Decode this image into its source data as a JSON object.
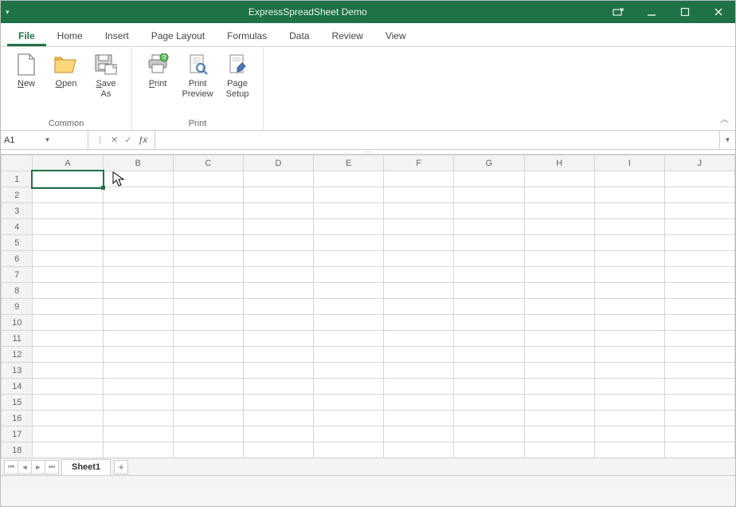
{
  "titlebar": {
    "title": "ExpressSpreadSheet Demo"
  },
  "tabs": {
    "file": "File",
    "home": "Home",
    "insert": "Insert",
    "layout": "Page Layout",
    "formulas": "Formulas",
    "data": "Data",
    "review": "Review",
    "view": "View"
  },
  "ribbon": {
    "common": {
      "caption": "Common",
      "new": "ew",
      "new_pre": "N",
      "open": "pen",
      "open_pre": "O",
      "save": "ave\nAs",
      "save_pre": "S"
    },
    "print": {
      "caption": "Print",
      "print": "rint",
      "print_pre": "P",
      "preview": "Print\nPreview",
      "setup": "Page\nSetup"
    }
  },
  "namebox": "A1",
  "formula": "",
  "columns": [
    "A",
    "B",
    "C",
    "D",
    "E",
    "F",
    "G",
    "H",
    "I",
    "J"
  ],
  "rows": [
    "1",
    "2",
    "3",
    "4",
    "5",
    "6",
    "7",
    "8",
    "9",
    "10",
    "11",
    "12",
    "13",
    "14",
    "15",
    "16",
    "17",
    "18"
  ],
  "sheet": {
    "name": "Sheet1"
  },
  "selected": {
    "col": "A",
    "row": "1"
  }
}
